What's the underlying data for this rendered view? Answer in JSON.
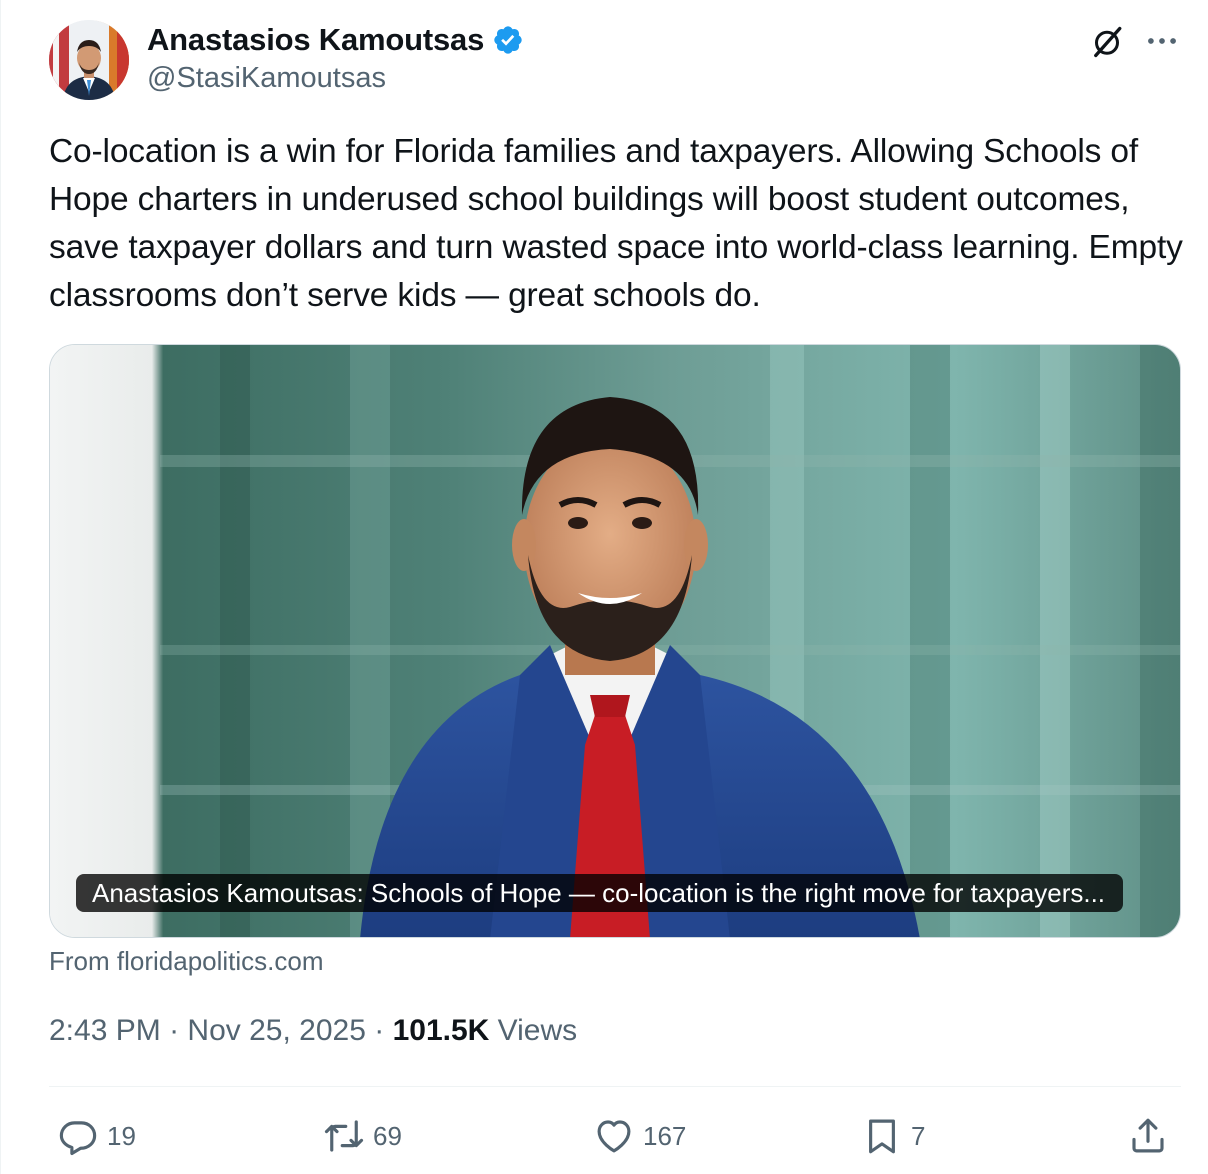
{
  "author": {
    "name": "Anastasios Kamoutsas",
    "handle": "@StasiKamoutsas",
    "verified": true,
    "verified_color": "#1d9bf0"
  },
  "tweet": {
    "text": "Co-location is a win for Florida families and taxpayers. Allowing Schools of Hope charters in underused school buildings will boost student outcomes, save taxpayer dollars and turn wasted space into world-class learning. Empty classrooms don’t serve kids — great schools do."
  },
  "card": {
    "title": "Anastasios Kamoutsas: Schools of Hope — co-location is the right move for taxpayers...",
    "source": "From floridapolitics.com"
  },
  "meta": {
    "time": "2:43 PM",
    "separator": "·",
    "date": "Nov 25, 2025",
    "views_count": "101.5K",
    "views_label": "Views"
  },
  "actions": {
    "replies": "19",
    "reposts": "69",
    "likes": "167",
    "bookmarks": "7"
  },
  "icons": {
    "header": [
      "grok-icon",
      "more-icon"
    ],
    "action_bar": [
      "reply-icon",
      "repost-icon",
      "like-icon",
      "bookmark-icon",
      "share-icon"
    ]
  },
  "colors": {
    "text_primary": "#0f1419",
    "text_secondary": "#536471",
    "border": "#cfd9de"
  }
}
